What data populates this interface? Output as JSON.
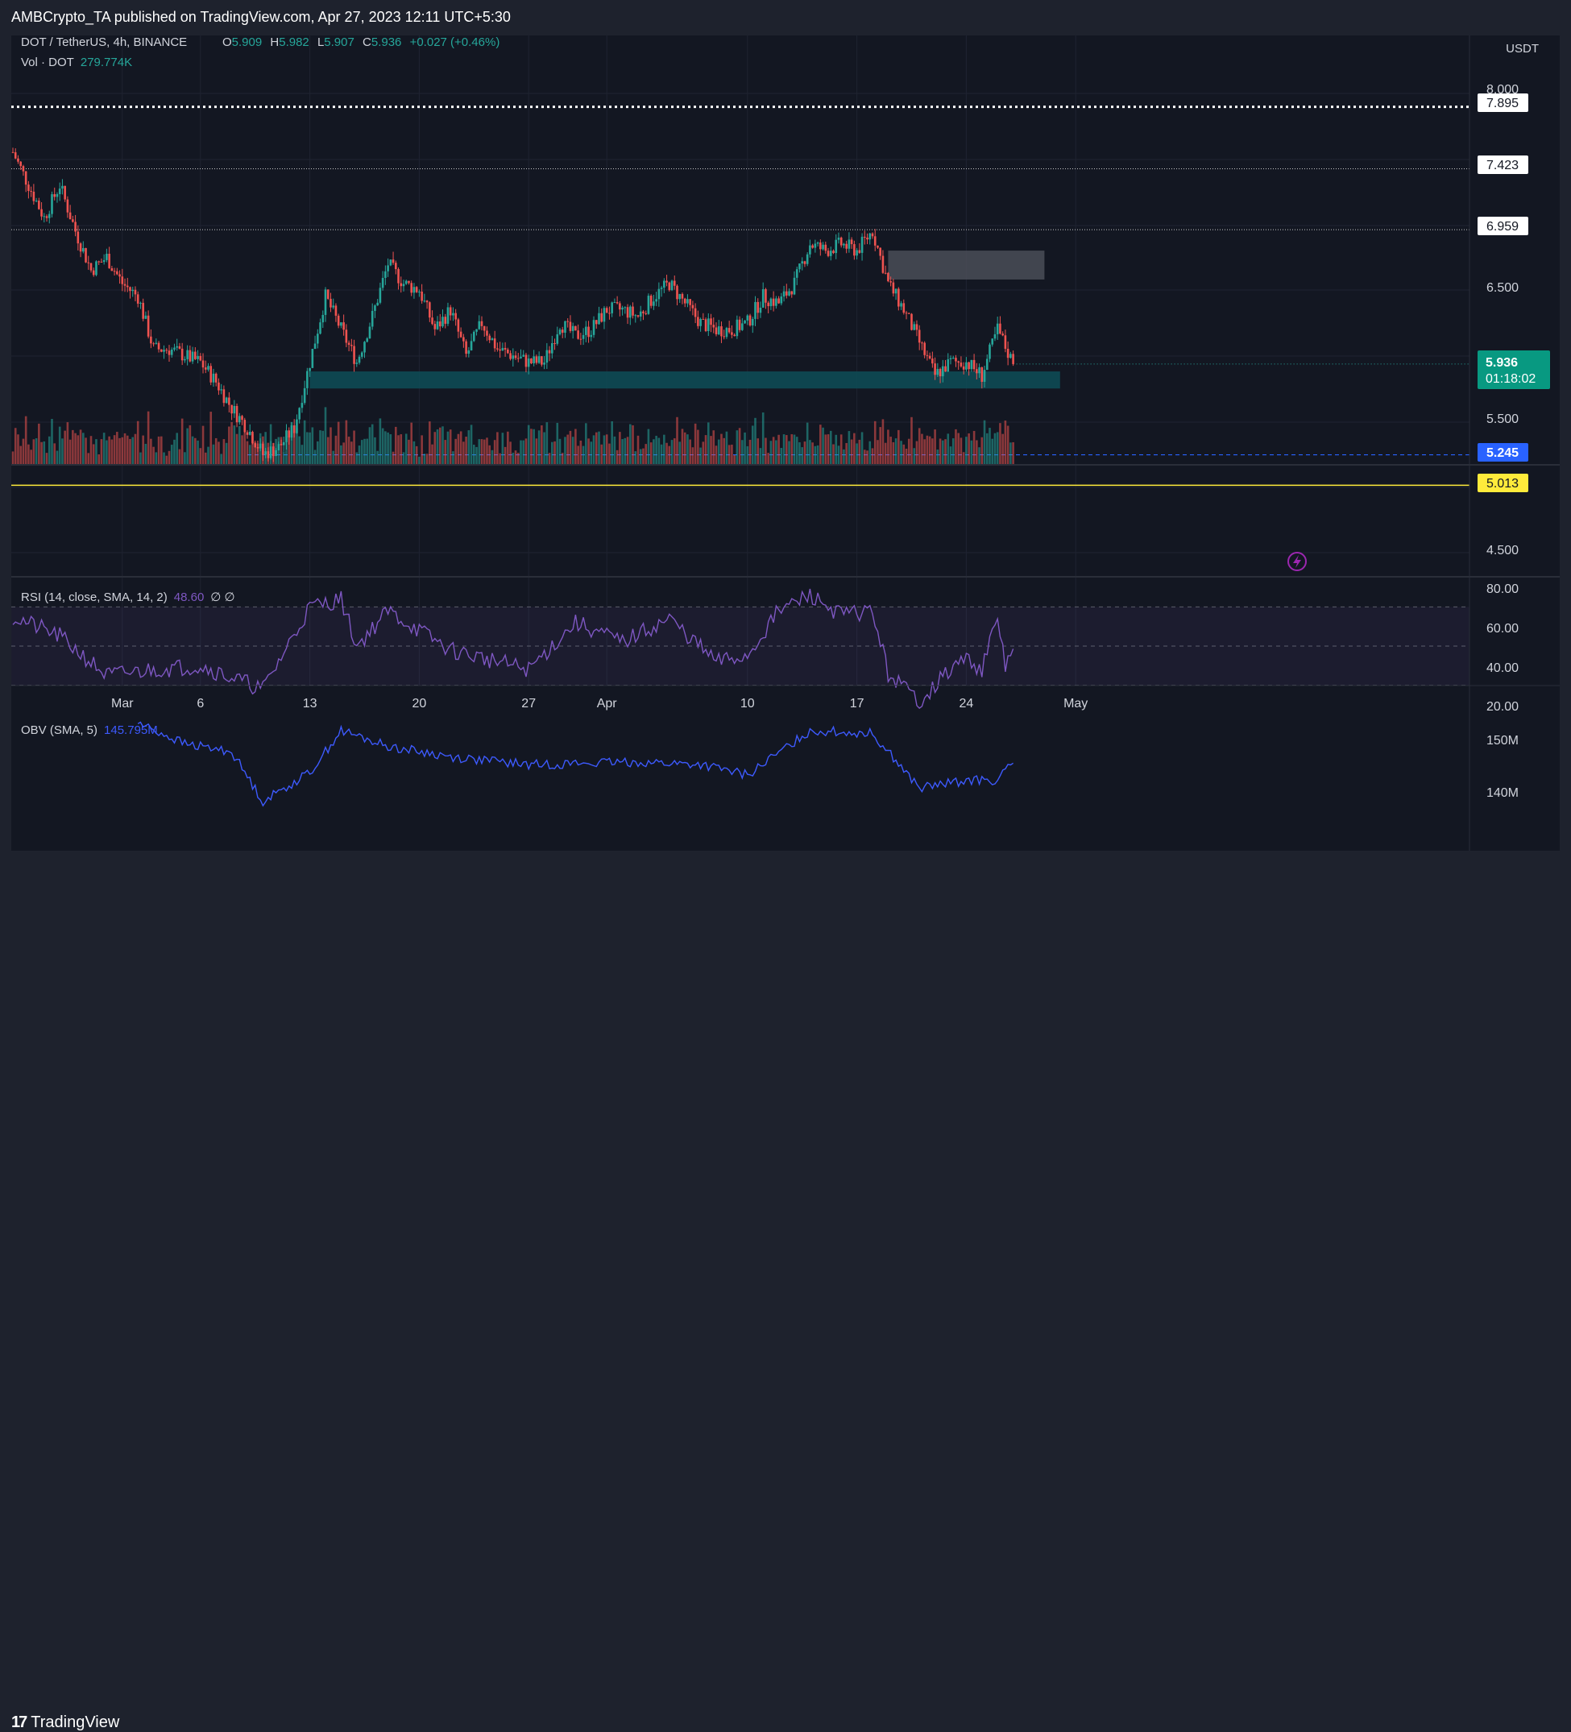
{
  "header": {
    "published": "AMBCrypto_TA published on TradingView.com, Apr 27, 2023 12:11 UTC+5:30"
  },
  "legend": {
    "symbol": "DOT / TetherUS, 4h, BINANCE",
    "o_label": "O",
    "o": "5.909",
    "h_label": "H",
    "h": "5.982",
    "l_label": "L",
    "l": "5.907",
    "c_label": "C",
    "c": "5.936",
    "change": "+0.027 (+0.46%)",
    "vol_label": "Vol · DOT",
    "vol": "279.774K"
  },
  "price_scale": {
    "currency": "USDT",
    "ticks": [
      "8.000",
      "6.500",
      "5.500",
      "4.500"
    ],
    "badges": {
      "level_7895": "7.895",
      "level_7423": "7.423",
      "level_6959": "6.959",
      "current": "5.936",
      "countdown": "01:18:02",
      "level_5245": "5.245",
      "level_5013": "5.013"
    }
  },
  "rsi": {
    "label": "RSI (14, close, SMA, 14, 2)",
    "value": "48.60",
    "extra": "∅ ∅",
    "ticks": [
      "80.00",
      "60.00",
      "40.00",
      "20.00"
    ]
  },
  "obv": {
    "label": "OBV (SMA, 5)",
    "value": "145.795M",
    "ticks": [
      "150M",
      "140M"
    ]
  },
  "time_axis": [
    "Mar",
    "6",
    "13",
    "20",
    "27",
    "Apr",
    "10",
    "17",
    "24",
    "May"
  ],
  "branding": {
    "name": "TradingView",
    "mark": "17"
  },
  "colors": {
    "bull": "#26a69a",
    "bear": "#ef5350",
    "rsi": "#7e57c2",
    "obv": "#3d5afe",
    "support_zone": "#0e4d57",
    "resist_zone": "#4a4d57",
    "yellow": "#ffeb3b",
    "blue": "#2962ff"
  },
  "chart_data": [
    {
      "type": "candlestick",
      "symbol": "DOT/USDT",
      "interval": "4h",
      "ylabel": "USDT",
      "ylim": [
        4.3,
        8.2
      ],
      "x_ticks": [
        "Mar",
        "6",
        "13",
        "20",
        "27",
        "Apr",
        "10",
        "17",
        "24",
        "May"
      ],
      "close_path": [
        [
          "Feb 22",
          7.55
        ],
        [
          "Feb 23",
          7.3
        ],
        [
          "Feb 24",
          7.05
        ],
        [
          "Feb 25",
          7.3
        ],
        [
          "Feb 26",
          6.95
        ],
        [
          "Feb 27",
          6.65
        ],
        [
          "Feb 28",
          6.75
        ],
        [
          "Mar 1",
          6.55
        ],
        [
          "Mar 2",
          6.45
        ],
        [
          "Mar 3",
          6.05
        ],
        [
          "Mar 4",
          6.05
        ],
        [
          "Mar 5",
          6.0
        ],
        [
          "Mar 6",
          5.95
        ],
        [
          "Mar 7",
          5.8
        ],
        [
          "Mar 8",
          5.6
        ],
        [
          "Mar 9",
          5.45
        ],
        [
          "Mar 10",
          5.25
        ],
        [
          "Mar 11",
          5.3
        ],
        [
          "Mar 12",
          5.45
        ],
        [
          "Mar 13",
          5.95
        ],
        [
          "Mar 14",
          6.45
        ],
        [
          "Mar 15",
          6.2
        ],
        [
          "Mar 16",
          5.95
        ],
        [
          "Mar 17",
          6.3
        ],
        [
          "Mar 18",
          6.7
        ],
        [
          "Mar 19",
          6.55
        ],
        [
          "Mar 20",
          6.5
        ],
        [
          "Mar 21",
          6.2
        ],
        [
          "Mar 22",
          6.35
        ],
        [
          "Mar 23",
          6.0
        ],
        [
          "Mar 24",
          6.25
        ],
        [
          "Mar 25",
          6.05
        ],
        [
          "Mar 26",
          6.0
        ],
        [
          "Mar 27",
          5.95
        ],
        [
          "Mar 28",
          5.95
        ],
        [
          "Mar 29",
          6.25
        ],
        [
          "Mar 30",
          6.15
        ],
        [
          "Mar 31",
          6.2
        ],
        [
          "Apr 1",
          6.35
        ],
        [
          "Apr 2",
          6.35
        ],
        [
          "Apr 3",
          6.3
        ],
        [
          "Apr 4",
          6.45
        ],
        [
          "Apr 5",
          6.55
        ],
        [
          "Apr 6",
          6.4
        ],
        [
          "Apr 7",
          6.25
        ],
        [
          "Apr 8",
          6.2
        ],
        [
          "Apr 9",
          6.2
        ],
        [
          "Apr 10",
          6.25
        ],
        [
          "Apr 11",
          6.45
        ],
        [
          "Apr 12",
          6.4
        ],
        [
          "Apr 13",
          6.55
        ],
        [
          "Apr 14",
          6.85
        ],
        [
          "Apr 15",
          6.8
        ],
        [
          "Apr 16",
          6.85
        ],
        [
          "Apr 17",
          6.8
        ],
        [
          "Apr 18",
          6.95
        ],
        [
          "Apr 19",
          6.55
        ],
        [
          "Apr 20",
          6.35
        ],
        [
          "Apr 21",
          6.1
        ],
        [
          "Apr 22",
          5.85
        ],
        [
          "Apr 23",
          5.95
        ],
        [
          "Apr 24",
          5.95
        ],
        [
          "Apr 25",
          5.85
        ],
        [
          "Apr 26",
          6.2
        ],
        [
          "Apr 27",
          5.936
        ]
      ],
      "horizontal_levels": [
        7.895,
        7.423,
        6.959,
        5.245,
        5.013
      ],
      "zones": [
        {
          "name": "support",
          "from": 5.75,
          "to": 5.88,
          "start": "Mar 13",
          "end": "Apr 30"
        },
        {
          "name": "resistance",
          "from": 6.58,
          "to": 6.8,
          "start": "Apr 19",
          "end": "Apr 29"
        }
      ],
      "last_price": 5.936
    },
    {
      "type": "line",
      "name": "RSI (14, close, SMA, 14, 2)",
      "ylim": [
        15,
        85
      ],
      "bands": [
        70,
        50,
        30
      ],
      "last_value": 48.6,
      "path": [
        [
          "Feb 22",
          65
        ],
        [
          "Feb 25",
          55
        ],
        [
          "Feb 28",
          35
        ],
        [
          "Mar 3",
          38
        ],
        [
          "Mar 6",
          40
        ],
        [
          "Mar 10",
          28
        ],
        [
          "Mar 13",
          70
        ],
        [
          "Mar 15",
          74
        ],
        [
          "Mar 16",
          50
        ],
        [
          "Mar 18",
          68
        ],
        [
          "Mar 22",
          48
        ],
        [
          "Mar 25",
          42
        ],
        [
          "Mar 27",
          38
        ],
        [
          "Mar 30",
          62
        ],
        [
          "Apr 2",
          52
        ],
        [
          "Apr 5",
          64
        ],
        [
          "Apr 8",
          42
        ],
        [
          "Apr 10",
          45
        ],
        [
          "Apr 12",
          68
        ],
        [
          "Apr 14",
          76
        ],
        [
          "Apr 16",
          66
        ],
        [
          "Apr 18",
          68
        ],
        [
          "Apr 19",
          36
        ],
        [
          "Apr 21",
          22
        ],
        [
          "Apr 23",
          38
        ],
        [
          "Apr 24",
          44
        ],
        [
          "Apr 25",
          38
        ],
        [
          "Apr 26",
          64
        ],
        [
          "Apr 26.5",
          40
        ],
        [
          "Apr 27",
          48.6
        ]
      ]
    },
    {
      "type": "line",
      "name": "OBV (SMA, 5)",
      "ylabel": "M",
      "ylim": [
        137,
        153
      ],
      "last_value": 145.795,
      "path": [
        [
          "Mar 2",
          153.5
        ],
        [
          "Mar 5",
          149.5
        ],
        [
          "Mar 8",
          148
        ],
        [
          "Mar 10",
          138.5
        ],
        [
          "Mar 13",
          144
        ],
        [
          "Mar 15",
          152
        ],
        [
          "Mar 18",
          149
        ],
        [
          "Mar 22",
          147
        ],
        [
          "Mar 27",
          145.5
        ],
        [
          "Apr 3",
          146
        ],
        [
          "Apr 7",
          145.5
        ],
        [
          "Apr 10",
          143.5
        ],
        [
          "Apr 14",
          152
        ],
        [
          "Apr 18",
          151.5
        ],
        [
          "Apr 21",
          141
        ],
        [
          "Apr 24",
          142.5
        ],
        [
          "Apr 26",
          142.5
        ],
        [
          "Apr 27",
          145.8
        ]
      ]
    }
  ]
}
